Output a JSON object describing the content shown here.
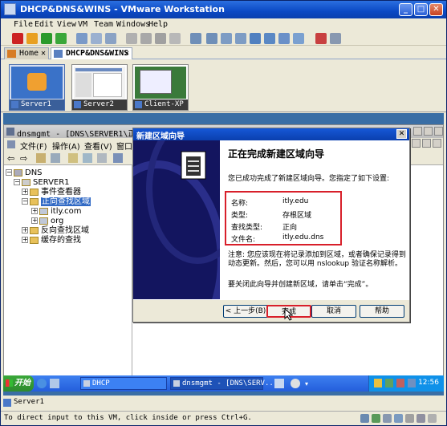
{
  "window": {
    "title": "DHCP&DNS&WINS - VMware Workstation",
    "minimize": "_",
    "maximize": "□",
    "close": "✕"
  },
  "menu": [
    "File",
    "Edit",
    "View",
    "VM",
    "Team",
    "Windows",
    "Help"
  ],
  "tabs": [
    {
      "label": "Home",
      "close": "✕"
    },
    {
      "label": "DHCP&DNS&WINS",
      "close": "✕"
    }
  ],
  "thumbnails": [
    "Server1",
    "Server2",
    "Client-XP"
  ],
  "mmc": {
    "title": "dnsmgmt - [DNS\\SERVER1\\正向查找...",
    "menu": [
      "文件(F)",
      "操作(A)",
      "查看(V)",
      "窗口("
    ],
    "tree": {
      "root": "DNS",
      "server": "SERVER1",
      "events": "事件查看器",
      "forward": "正向查找区域",
      "zone1": "itly.com",
      "zone2": "org",
      "reverse": "反向查找区域",
      "cache": "缓存的查找"
    }
  },
  "wizard": {
    "title": "新建区域向导",
    "close": "✕",
    "heading": "正在完成新建区域向导",
    "intro": "您已成功完成了新建区域向导。您指定了如下设置:",
    "summary": [
      {
        "key": "名称:",
        "value": "itly.edu"
      },
      {
        "key": "类型:",
        "value": "存根区域"
      },
      {
        "key": "查找类型:",
        "value": "正向"
      },
      {
        "key": "文件名:",
        "value": "itly.edu.dns"
      }
    ],
    "note": "注意: 您应该现在将记录添加到区域，或者确保记录得到动态更新。然后，您可以用 nslookup 验证名称解析。",
    "finish_hint": "要关闭此向导并创建新区域，请单击“完成”。",
    "buttons": {
      "back": "< 上一步(B)",
      "finish": "完成",
      "cancel": "取消",
      "help": "帮助"
    }
  },
  "taskbar": {
    "start": "开始",
    "items": [
      "DHCP",
      "dnsmgmt - [DNS\\SERV..."
    ],
    "clock": "12:56"
  },
  "vm_name": "Server1",
  "status": "To direct input to this VM, click inside or press Ctrl+G.",
  "colors": {
    "highlight": "#d81f2a",
    "title_blue": "#0b49c4",
    "wizard_left": "#13155f"
  }
}
